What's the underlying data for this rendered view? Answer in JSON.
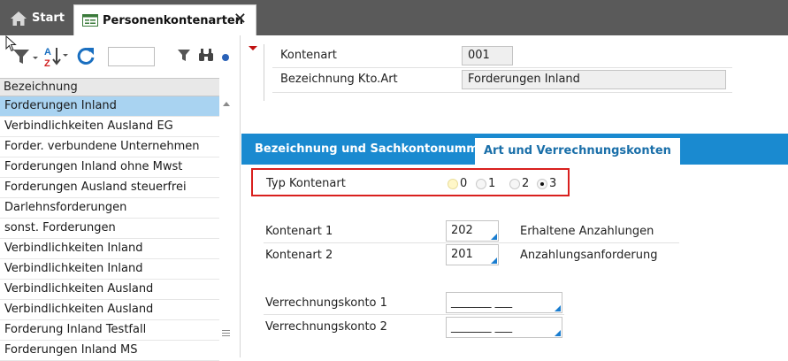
{
  "tabs": {
    "start_label": "Start",
    "active_label": "Personenkontenarten",
    "close_symbol": "✕"
  },
  "left_panel": {
    "column_header": "Bezeichnung",
    "search_value": "",
    "items": [
      "Forderungen Inland",
      "Verbindlichkeiten Ausland EG",
      "Forder. verbundene Unternehmen",
      "Forderungen Inland ohne Mwst",
      "Forderungen Ausland steuerfrei",
      "Darlehnsforderungen",
      "sonst. Forderungen",
      "Verbindlichkeiten Inland",
      "Verbindlichkeiten Inland",
      "Verbindlichkeiten Ausland",
      "Verbindlichkeiten Ausland",
      "Forderung Inland Testfall",
      "Forderungen Inland MS"
    ],
    "selected_index": 0
  },
  "header": {
    "kontenart_label": "Kontenart",
    "kontenart_value": "001",
    "bezeichnung_label": "Bezeichnung Kto.Art",
    "bezeichnung_value": "Forderungen Inland"
  },
  "section_tabs": {
    "tab1": "Bezeichnung und Sachkontonummer",
    "tab2": "Art und Verrechnungskonten"
  },
  "typ": {
    "label": "Typ Kontenart",
    "options": [
      "0",
      "1",
      "2",
      "3"
    ],
    "selected": "3"
  },
  "konten": {
    "k1_label": "Kontenart 1",
    "k1_value": "202",
    "k1_desc": "Erhaltene Anzahlungen",
    "k2_label": "Kontenart 2",
    "k2_value": "201",
    "k2_desc": "Anzahlungsanforderung",
    "v1_label": "Verrechnungskonto 1",
    "v1_value": "_______ ___",
    "v2_label": "Verrechnungskonto 2",
    "v2_value": "_______ ___"
  },
  "colors": {
    "accent": "#1a8ad0",
    "selection": "#a9d3f1",
    "highlight_border": "#d9201e"
  }
}
